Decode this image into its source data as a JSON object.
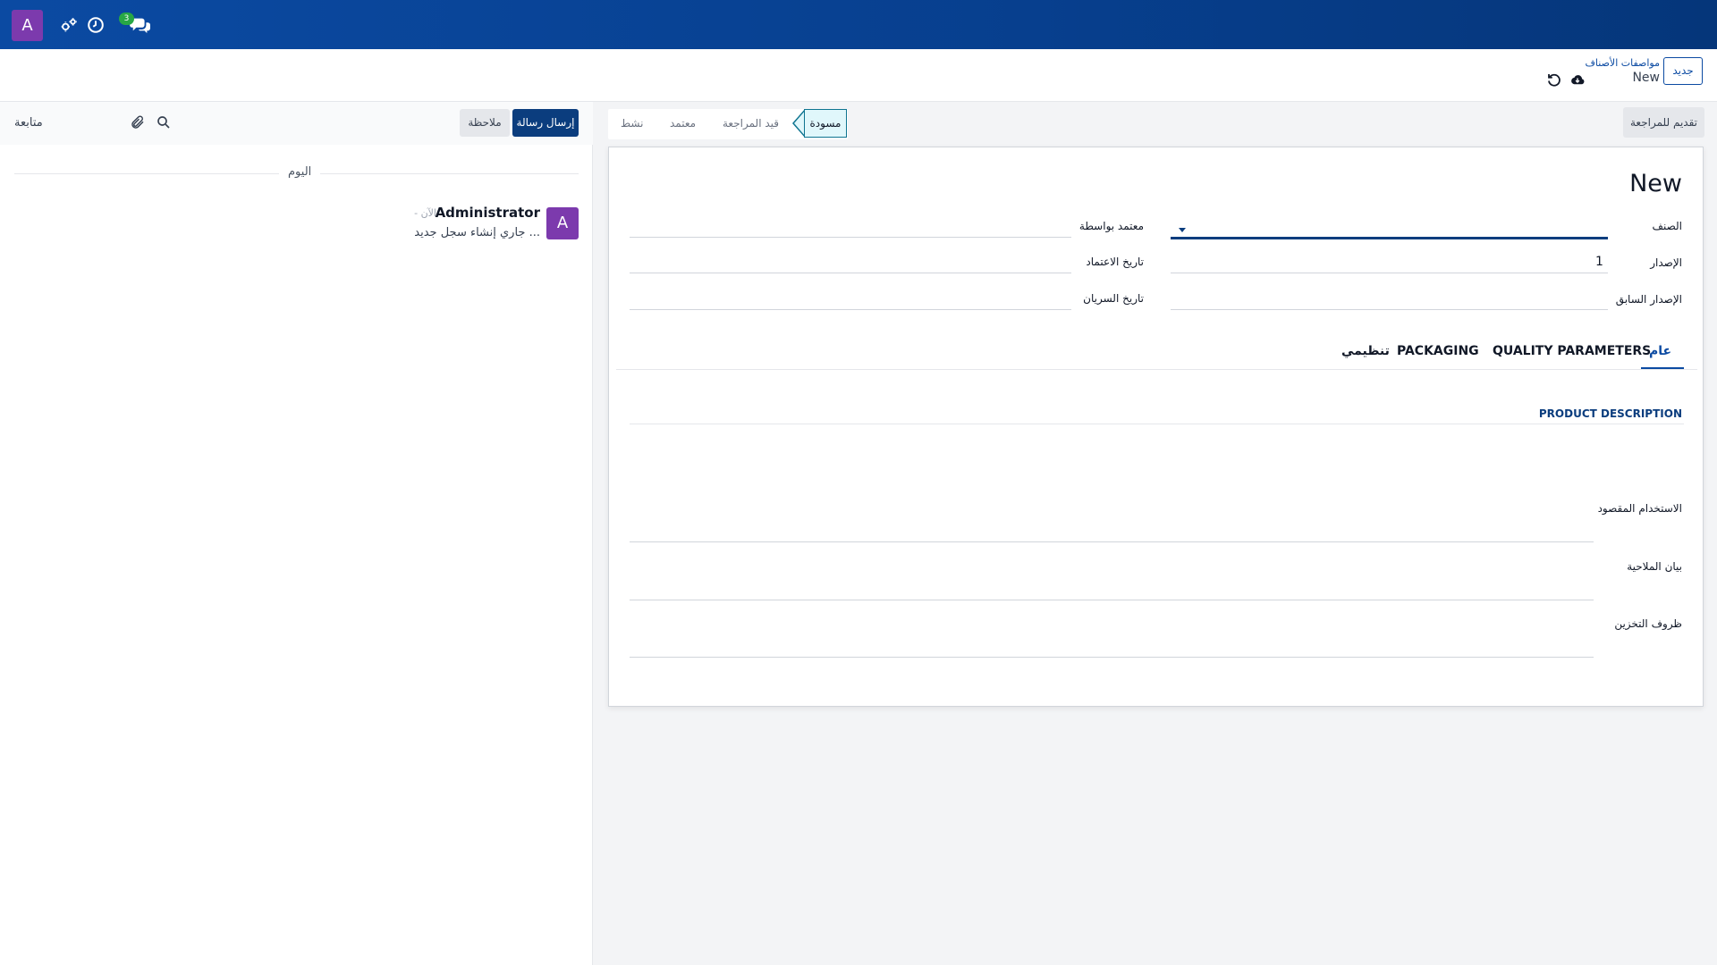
{
  "navbar": {
    "avatar_letter": "A",
    "chat_badge_count": "3",
    "icons": [
      "chat-icon",
      "clock-icon",
      "settings-icon"
    ]
  },
  "control_panel": {
    "new_button": "جديد",
    "breadcrumb_parent": "مواصفات الأصناف",
    "breadcrumb_current": "New",
    "icons": [
      "cloud-save-icon",
      "discard-icon"
    ]
  },
  "chatter": {
    "follow_label": "متابعة",
    "log_note_button": "ملاحظة",
    "send_message_button": "إرسال رسالة",
    "date_separator": "اليوم",
    "message": {
      "avatar_letter": "A",
      "author": "Administrator",
      "time": "- الآن",
      "body": "جاري إنشاء سجل جديد ..."
    }
  },
  "form": {
    "submit_review_button": "تقديم للمراجعة",
    "stages": {
      "active": "مسودة",
      "under_review": "قيد المراجعة",
      "approved": "معتمد",
      "active_state": "نشط"
    },
    "title": "New",
    "fields": {
      "product_label": "الصنف",
      "product_value": "",
      "version_label": "الإصدار",
      "version_value": "1",
      "previous_version_label": "الإصدار السابق",
      "approved_by_label": "معتمد بواسطة",
      "approval_date_label": "تاريخ الاعتماد",
      "effective_date_label": "تاريخ السريان"
    },
    "tabs": {
      "general": "عام",
      "quality_parameters": "QUALITY PARAMETERS",
      "packaging": "PACKAGING",
      "regulatory": "تنظيمي"
    },
    "section_title": "PRODUCT DESCRIPTION",
    "description_fields": {
      "intended_use": "الاستخدام المقصود",
      "appearance": "بيان الملاحية",
      "storage": "ظروف التخزين"
    }
  },
  "colors": {
    "navbar": "#0b4aa2",
    "primary": "#0b3d7e",
    "avatar": "#7c3aad",
    "badge": "#28a745",
    "active_stage_bg": "#e0f7fb"
  }
}
